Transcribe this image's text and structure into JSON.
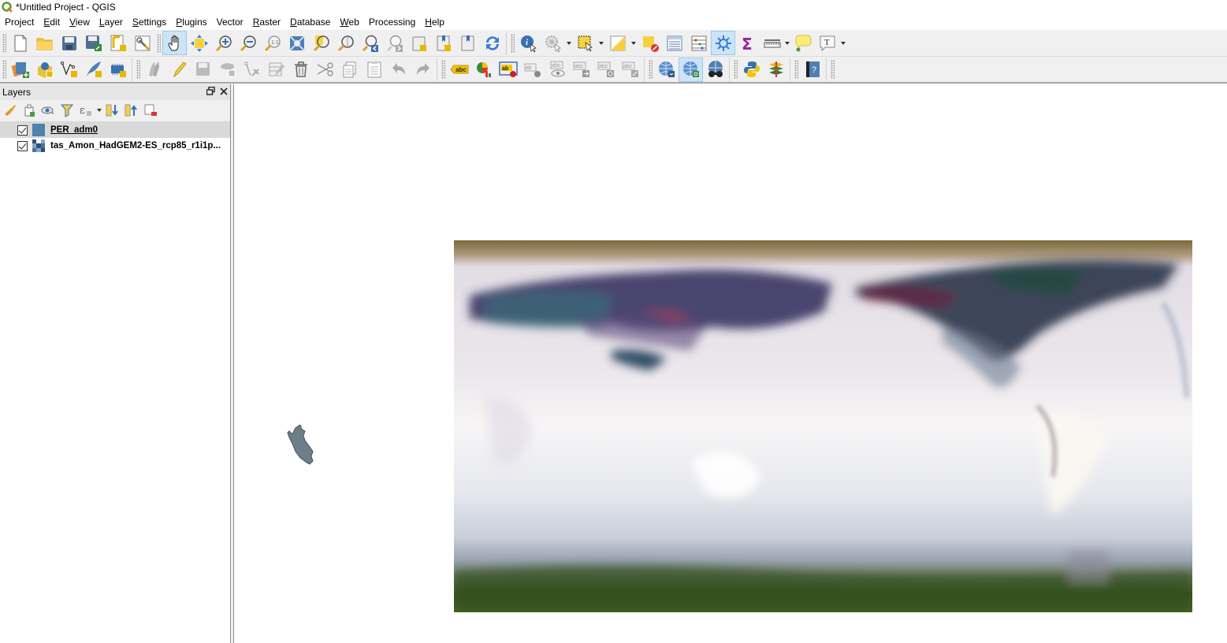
{
  "window": {
    "title": "*Untitled Project - QGIS",
    "app_icon": "qgis-logo-icon"
  },
  "menubar": {
    "items": [
      {
        "label": "Project",
        "accel": ""
      },
      {
        "label": "Edit",
        "accel": "E"
      },
      {
        "label": "View",
        "accel": "V"
      },
      {
        "label": "Layer",
        "accel": "L"
      },
      {
        "label": "Settings",
        "accel": "S"
      },
      {
        "label": "Plugins",
        "accel": "P"
      },
      {
        "label": "Vector",
        "accel": ""
      },
      {
        "label": "Raster",
        "accel": "R"
      },
      {
        "label": "Database",
        "accel": "D"
      },
      {
        "label": "Web",
        "accel": "W"
      },
      {
        "label": "Processing",
        "accel": ""
      },
      {
        "label": "Help",
        "accel": "H"
      }
    ]
  },
  "toolbar_row1": {
    "project": [
      "new-project-icon",
      "open-project-icon",
      "save-project-icon",
      "save-as-icon",
      "new-print-layout-icon",
      "layout-manager-icon"
    ],
    "navigation": [
      "pan-icon",
      "pan-to-selection-icon",
      "zoom-in-icon",
      "zoom-out-icon",
      "zoom-native-icon",
      "zoom-full-icon",
      "zoom-to-selection-icon",
      "zoom-to-layer-icon",
      "zoom-last-icon",
      "zoom-next-icon",
      "new-map-view-icon",
      "new-bookmark-icon",
      "show-bookmarks-icon",
      "refresh-icon"
    ],
    "attributes": [
      "identify-icon",
      "run-action-icon",
      "select-features-icon",
      "select-by-value-icon",
      "deselect-icon",
      "attribute-table-icon",
      "field-calculator-icon",
      "toolbox-icon",
      "statistics-icon",
      "measure-icon",
      "map-tips-icon",
      "text-annotation-icon"
    ],
    "active_tool": "pan-icon",
    "active_toggle": "toolbox-icon"
  },
  "toolbar_row2": {
    "manage_layers": [
      "data-source-manager-icon",
      "new-geopackage-icon",
      "new-shapefile-icon",
      "new-spatialite-icon",
      "new-virtual-layer-icon"
    ],
    "digitizing": [
      "current-edits-icon",
      "toggle-editing-icon",
      "save-edits-icon",
      "add-feature-icon",
      "vertex-tool-icon",
      "modify-attributes-icon",
      "delete-selected-icon",
      "cut-features-icon",
      "copy-features-icon",
      "paste-features-icon",
      "undo-icon",
      "redo-icon"
    ],
    "labels": [
      "layer-labeling-icon",
      "layer-diagram-icon",
      "highlight-pinned-icon",
      "pin-labels-icon",
      "show-hide-labels-icon",
      "move-label-icon",
      "rotate-label-icon",
      "change-label-icon"
    ],
    "web": [
      "metasearch-icon",
      "metasearch-active-icon",
      "openlayers-icon"
    ],
    "plugins": [
      "python-console-icon",
      "processing-plugin-icon"
    ],
    "help": [
      "help-icon"
    ]
  },
  "layers_panel": {
    "title": "Layers",
    "tools": [
      "open-styling-icon",
      "add-group-icon",
      "manage-themes-icon",
      "filter-legend-icon",
      "filter-expression-icon",
      "expand-all-icon",
      "collapse-all-icon",
      "remove-layer-icon"
    ],
    "layers": [
      {
        "name": "PER_adm0",
        "checked": true,
        "type": "vector",
        "selected": true,
        "color": "#4f81aa"
      },
      {
        "name": "tas_Amon_HadGEM2-ES_rcp85_r1i1p...",
        "checked": true,
        "type": "raster",
        "selected": false
      }
    ]
  },
  "map_canvas": {
    "vector_fill": "#6d7e88",
    "vector_stroke": "#4a555c",
    "raster_layer": "tas_Amon_HadGEM2-ES_rcp85_r1i1p...",
    "vector_layer": "PER_adm0"
  }
}
